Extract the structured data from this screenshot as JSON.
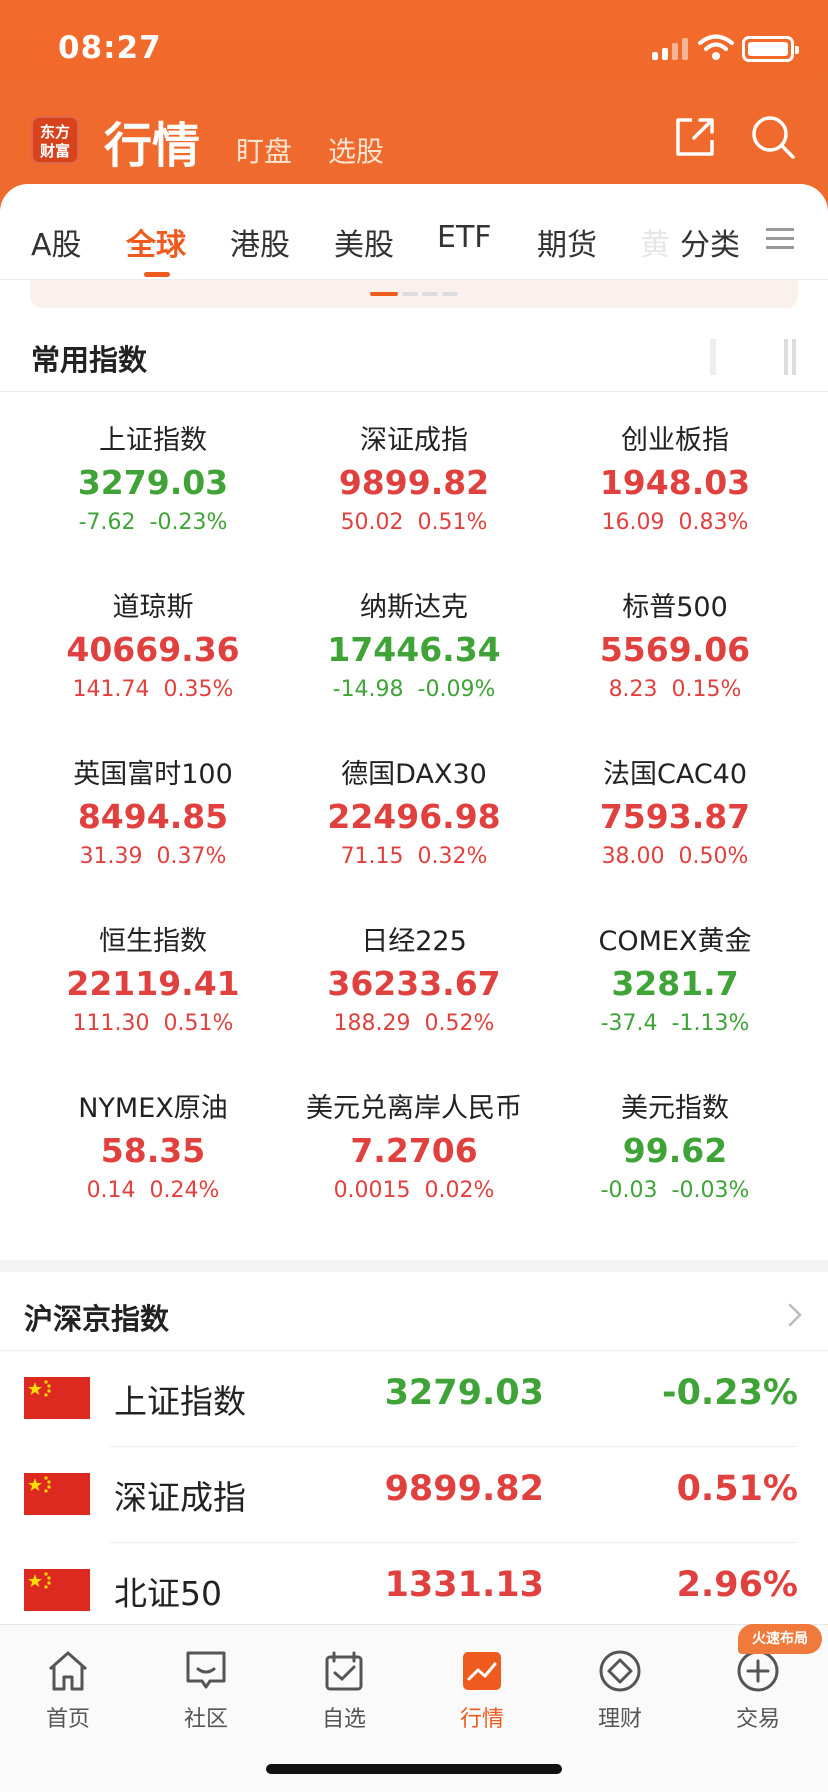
{
  "status_bar": {
    "time": "08:27"
  },
  "header": {
    "logo_text_line1": "东方",
    "logo_text_line2": "财富",
    "title": "行情",
    "sub_tabs": [
      "盯盘",
      "选股"
    ]
  },
  "market_tabs": {
    "items": [
      "A股",
      "全球",
      "港股",
      "美股",
      "ETF",
      "期货"
    ],
    "active": "全球",
    "faded_item": "黄",
    "category_label": "分类"
  },
  "common_indices": {
    "title": "常用指数",
    "items": [
      {
        "name": "上证指数",
        "price": "3279.03",
        "change": "-7.62",
        "pct": "-0.23%",
        "dir": "down"
      },
      {
        "name": "深证成指",
        "price": "9899.82",
        "change": "50.02",
        "pct": "0.51%",
        "dir": "up"
      },
      {
        "name": "创业板指",
        "price": "1948.03",
        "change": "16.09",
        "pct": "0.83%",
        "dir": "up"
      },
      {
        "name": "道琼斯",
        "price": "40669.36",
        "change": "141.74",
        "pct": "0.35%",
        "dir": "up"
      },
      {
        "name": "纳斯达克",
        "price": "17446.34",
        "change": "-14.98",
        "pct": "-0.09%",
        "dir": "down"
      },
      {
        "name": "标普500",
        "price": "5569.06",
        "change": "8.23",
        "pct": "0.15%",
        "dir": "up"
      },
      {
        "name": "英国富时100",
        "price": "8494.85",
        "change": "31.39",
        "pct": "0.37%",
        "dir": "up"
      },
      {
        "name": "德国DAX30",
        "price": "22496.98",
        "change": "71.15",
        "pct": "0.32%",
        "dir": "up"
      },
      {
        "name": "法国CAC40",
        "price": "7593.87",
        "change": "38.00",
        "pct": "0.50%",
        "dir": "up"
      },
      {
        "name": "恒生指数",
        "price": "22119.41",
        "change": "111.30",
        "pct": "0.51%",
        "dir": "up"
      },
      {
        "name": "日经225",
        "price": "36233.67",
        "change": "188.29",
        "pct": "0.52%",
        "dir": "up"
      },
      {
        "name": "COMEX黄金",
        "price": "3281.7",
        "change": "-37.4",
        "pct": "-1.13%",
        "dir": "down"
      },
      {
        "name": "NYMEX原油",
        "price": "58.35",
        "change": "0.14",
        "pct": "0.24%",
        "dir": "up"
      },
      {
        "name": "美元兑离岸人民币",
        "price": "7.2706",
        "change": "0.0015",
        "pct": "0.02%",
        "dir": "up"
      },
      {
        "name": "美元指数",
        "price": "99.62",
        "change": "-0.03",
        "pct": "-0.03%",
        "dir": "down"
      }
    ]
  },
  "hs_indices": {
    "title": "沪深京指数",
    "rows": [
      {
        "name": "上证指数",
        "price": "3279.03",
        "pct": "-0.23%",
        "dir": "down"
      },
      {
        "name": "深证成指",
        "price": "9899.82",
        "pct": "0.51%",
        "dir": "up"
      },
      {
        "name": "北证50",
        "price": "1331.13",
        "pct": "2.96%",
        "dir": "up"
      }
    ]
  },
  "bottom_nav": {
    "items": [
      {
        "label": "首页",
        "icon": "home-icon"
      },
      {
        "label": "社区",
        "icon": "chat-icon"
      },
      {
        "label": "自选",
        "icon": "watchlist-icon"
      },
      {
        "label": "行情",
        "icon": "market-chart-icon"
      },
      {
        "label": "理财",
        "icon": "wealth-icon"
      },
      {
        "label": "交易",
        "icon": "trade-icon"
      }
    ],
    "active": "行情",
    "badge": "火速布局"
  },
  "colors": {
    "up": "#e0413f",
    "down": "#3fa338",
    "accent": "#ef5b1f",
    "header": "#f26a2c"
  }
}
